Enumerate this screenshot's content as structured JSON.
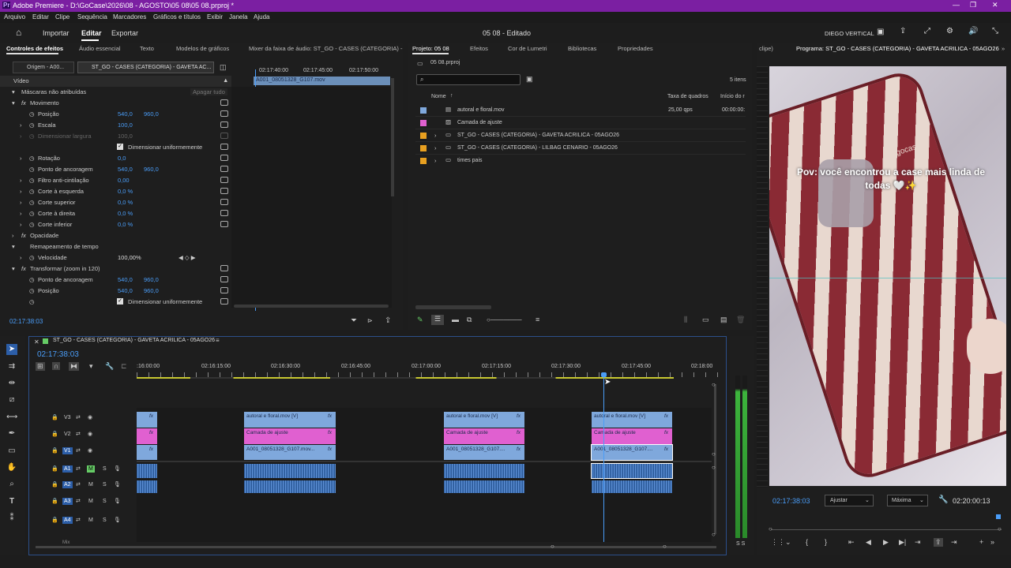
{
  "window": {
    "title": "Adobe Premiere - D:\\GoCase\\2026\\08 - AGOSTO\\05 08\\05 08.prproj *",
    "logo": "Pr"
  },
  "menu": [
    "Arquivo",
    "Editar",
    "Clipe",
    "Sequência",
    "Marcadores",
    "Gráficos e títulos",
    "Exibir",
    "Janela",
    "Ajuda"
  ],
  "appbar": {
    "import": "Importar",
    "edit": "Editar",
    "export": "Exportar",
    "doc": "05 08 - Editado",
    "workspace": "DIEGO VERTICAL"
  },
  "effects_panel": {
    "tabs": [
      "Controles de efeitos",
      "Áudio essencial",
      "Texto",
      "Modelos de gráficos",
      "Mixer da faixa de áudio: ST_GO - CASES (CATEGORIA) -"
    ],
    "source_tab": "Origem - A00...",
    "seq_tab": "ST_GO - CASES (CATEGORIA) - GAVETA AC...",
    "ruler": [
      "02:17:40:00",
      "02:17:45:00",
      "02:17:50:00"
    ],
    "clip_name": "A001_08051328_G107.mov",
    "clear_all": "Apagar tudo",
    "rows": [
      {
        "label": "Vídeo",
        "v1": "",
        "v2": ""
      },
      {
        "label": "Máscaras não atribuídas",
        "v1": "",
        "v2": ""
      },
      {
        "label": "Movimento",
        "v1": "",
        "v2": ""
      },
      {
        "label": "Posição",
        "v1": "540,0",
        "v2": "960,0"
      },
      {
        "label": "Escala",
        "v1": "100,0",
        "v2": ""
      },
      {
        "label": "Dimensionar largura",
        "v1": "100,0",
        "v2": ""
      },
      {
        "label": "Dimensionar uniformemente",
        "v1": "",
        "v2": ""
      },
      {
        "label": "Rotação",
        "v1": "0,0",
        "v2": ""
      },
      {
        "label": "Ponto de ancoragem",
        "v1": "540,0",
        "v2": "960,0"
      },
      {
        "label": "Filtro anti-cintilação",
        "v1": "0,00",
        "v2": ""
      },
      {
        "label": "Corte à esquerda",
        "v1": "0,0 %",
        "v2": ""
      },
      {
        "label": "Corte superior",
        "v1": "0,0 %",
        "v2": ""
      },
      {
        "label": "Corte à direita",
        "v1": "0,0 %",
        "v2": ""
      },
      {
        "label": "Corte inferior",
        "v1": "0,0 %",
        "v2": ""
      },
      {
        "label": "Opacidade",
        "v1": "",
        "v2": ""
      },
      {
        "label": "Remapeamento de tempo",
        "v1": "",
        "v2": ""
      },
      {
        "label": "Velocidade",
        "v1": "100,00%",
        "v2": ""
      },
      {
        "label": "Transformar (zoom in 120)",
        "v1": "",
        "v2": ""
      },
      {
        "label": "Ponto de ancoragem",
        "v1": "540,0",
        "v2": "960,0"
      },
      {
        "label": "Posição",
        "v1": "540,0",
        "v2": "960,0"
      },
      {
        "label": "Dimensionar uniformemente",
        "v1": "",
        "v2": ""
      }
    ],
    "timecode": "02:17:38:03"
  },
  "project_panel": {
    "tabs": [
      "Projeto: 05 08",
      "Efeitos",
      "Cor de Lumetri",
      "Bibliotecas",
      "Propriedades"
    ],
    "file": "05 08.prproj",
    "count": "5 itens",
    "headers": {
      "name": "Nome",
      "fps": "Taxa de quadros",
      "start": "Início do r"
    },
    "items": [
      {
        "name": "autoral e floral.mov",
        "fps": "25,00 qps",
        "start": "00:00:00:",
        "color": "#7fa8dc"
      },
      {
        "name": "Camada de ajuste",
        "fps": "",
        "start": "",
        "color": "#e060d0"
      },
      {
        "name": "ST_GO - CASES (CATEGORIA) - GAVETA ACRILICA - 05AGO26",
        "fps": "",
        "start": "",
        "color": "#e8a020"
      },
      {
        "name": "ST_GO - CASES (CATEGORIA) - LILBAG CENARIO - 05AGO26",
        "fps": "",
        "start": "",
        "color": "#e8a020"
      },
      {
        "name": "times pais",
        "fps": "",
        "start": "",
        "color": "#e8a020"
      }
    ]
  },
  "program": {
    "tabs": [
      "clipe)",
      "Programa: ST_GO - CASES (CATEGORIA) - GAVETA ACRILICA - 05AGO26"
    ],
    "overlay": "Pov: você encontrou a case mais linda de todas 🤍✨",
    "brand": "gocase",
    "timecode": "02:17:38:03",
    "fit": "Ajustar",
    "quality": "Máxima",
    "duration": "02:20:00:13"
  },
  "timeline": {
    "seq_name": "ST_GO - CASES (CATEGORIA) - GAVETA ACRILICA - 05AGO26",
    "timecode": "02:17:38:03",
    "ruler": [
      ":16:00:00",
      "02:16:15:00",
      "02:16:30:00",
      "02:16:45:00",
      "02:17:00:00",
      "02:17:15:00",
      "02:17:30:00",
      "02:17:45:00",
      "02:18:00"
    ],
    "tracks": [
      "V3",
      "V2",
      "V1",
      "A1",
      "A2",
      "A3",
      "A4"
    ],
    "track_m": "M",
    "track_s": "S",
    "mix": "Mix",
    "clip_labels": {
      "v3": "autoral e floral.mov [V]",
      "v2": "Camada de ajuste",
      "v1a": "A001_08051328_G107.mov...",
      "v1b": "A001_08051328_G107....",
      "v1c": "A001_08051328_G107....",
      "fx": "fx"
    },
    "meter": "S S"
  }
}
